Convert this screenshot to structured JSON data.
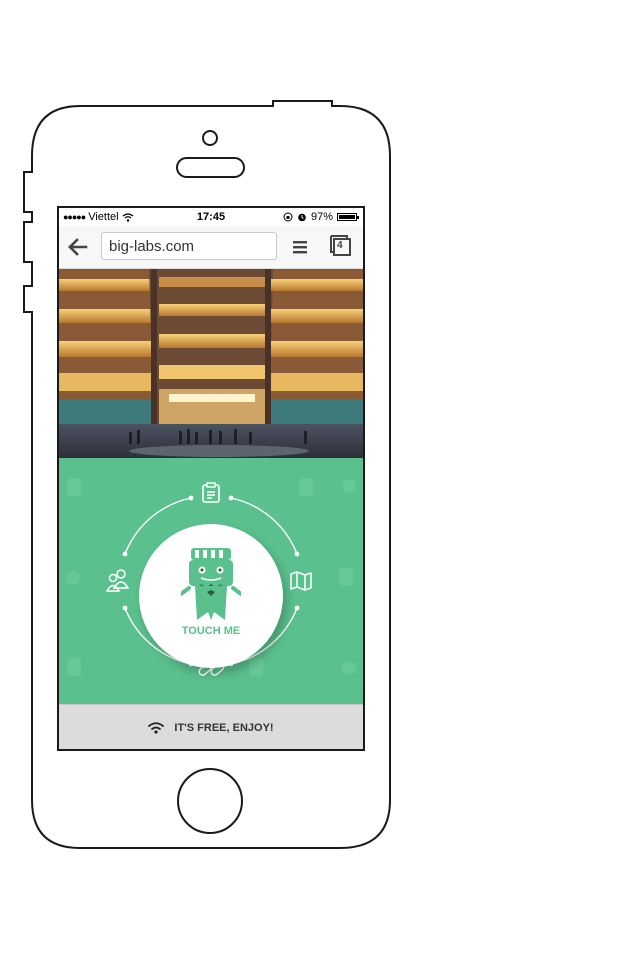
{
  "status_bar": {
    "carrier": "Viettel",
    "time": "17:45",
    "battery": "97%"
  },
  "browser": {
    "url": "big-labs.com",
    "tab_count": "4"
  },
  "main": {
    "cta_label": "TOUCH ME"
  },
  "footer": {
    "text": "IT'S FREE, ENJOY!"
  },
  "colors": {
    "brand_green": "#5ac18e",
    "footer_bg": "#dcdcdc"
  },
  "icons": [
    "back-arrow-icon",
    "hamburger-menu-icon",
    "tabs-icon",
    "wifi-icon",
    "clipboard-icon",
    "map-icon",
    "pills-icon",
    "people-icon",
    "mascot-icon"
  ]
}
